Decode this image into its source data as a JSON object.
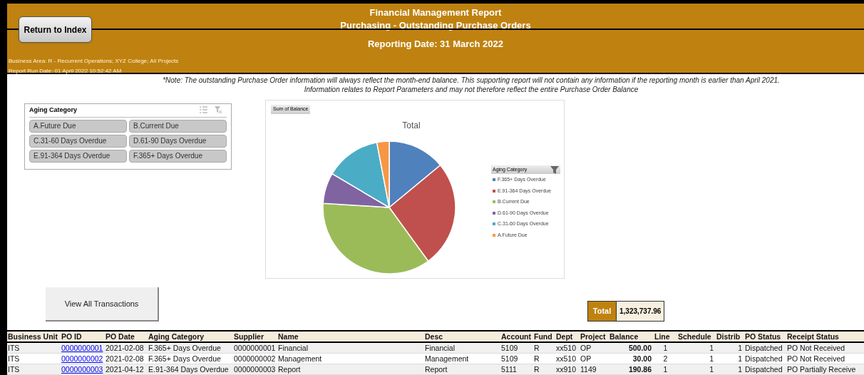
{
  "header": {
    "return_button": "Return to Index",
    "title": "Financial Management Report",
    "subtitle": "Purchasing - Outstanding Purchase Orders",
    "reporting_date": "Reporting Date: 31 March 2022",
    "business_area": "Business Area: R - Recurrent Operations; XYZ College; All Projects",
    "run_date": "Report Run Date: 01 April 2022 10:52:42 AM"
  },
  "notes": [
    "*Note: The outstanding Purchase Order information will always reflect the month-end balance. This supporting report will not contain any information if the reporting month is earlier than April 2021.",
    "Information relates to Report Parameters and may not therefore reflect the entire Purchase Order Balance"
  ],
  "slicer": {
    "title": "Aging Category",
    "items": [
      {
        "label": "A.Future Due",
        "selected": true
      },
      {
        "label": "B.Current Due",
        "selected": true
      },
      {
        "label": "C.31-60 Days Overdue",
        "selected": true
      },
      {
        "label": "D.61-90 Days Overdue",
        "selected": true
      },
      {
        "label": "E.91-364 Days Overdue",
        "selected": true
      },
      {
        "label": "F.365+ Days Overdue",
        "selected": true
      }
    ]
  },
  "chart": {
    "field_button": "Sum of Balance",
    "title": "Total",
    "legend_title": "Aging Category",
    "legend": [
      {
        "label": "F.365+ Days Overdue",
        "color": "#4f81bd"
      },
      {
        "label": "E.91-364 Days Overdue",
        "color": "#c0504d"
      },
      {
        "label": "B.Current Due",
        "color": "#9bbb59"
      },
      {
        "label": "D.61-90 Days Overdue",
        "color": "#8064a2"
      },
      {
        "label": "C.31-60 Days Overdue",
        "color": "#4bacc6"
      },
      {
        "label": "A.Future Due",
        "color": "#f79646"
      }
    ]
  },
  "view_button": "View All Transactions",
  "total": {
    "label": "Total",
    "value": "1,323,737.96"
  },
  "table": {
    "columns": [
      "Business Unit",
      "PO ID",
      "PO Date",
      "Aging Category",
      "Supplier",
      "Name",
      "Desc",
      "Account",
      "Fund",
      "Dept",
      "Project",
      "Balance",
      "Line",
      "Schedule",
      "Distrib",
      "PO Status",
      "Receipt Status"
    ],
    "rows": [
      [
        "ITS",
        "0000000001",
        "2021-02-08",
        "F.365+ Days Overdue",
        "0000000001",
        "Financial",
        "Financial",
        "5109",
        "R",
        "xx510",
        "OP",
        "500.00",
        "1",
        "1",
        "1",
        "Dispatched",
        "PO Not Received"
      ],
      [
        "ITS",
        "0000000002",
        "2021-02-08",
        "F.365+ Days Overdue",
        "0000000002",
        "Management",
        "Management",
        "5109",
        "R",
        "xx510",
        "OP",
        "30.00",
        "2",
        "1",
        "1",
        "Dispatched",
        "PO Not Received"
      ],
      [
        "ITS",
        "0000000003",
        "2021-04-12",
        "E.91-364 Days Overdue",
        "0000000003",
        "Report",
        "Report",
        "5111",
        "R",
        "xx910",
        "1149",
        "190.86",
        "1",
        "1",
        "1",
        "Dispatched",
        "PO Partially Receive"
      ]
    ]
  }
}
